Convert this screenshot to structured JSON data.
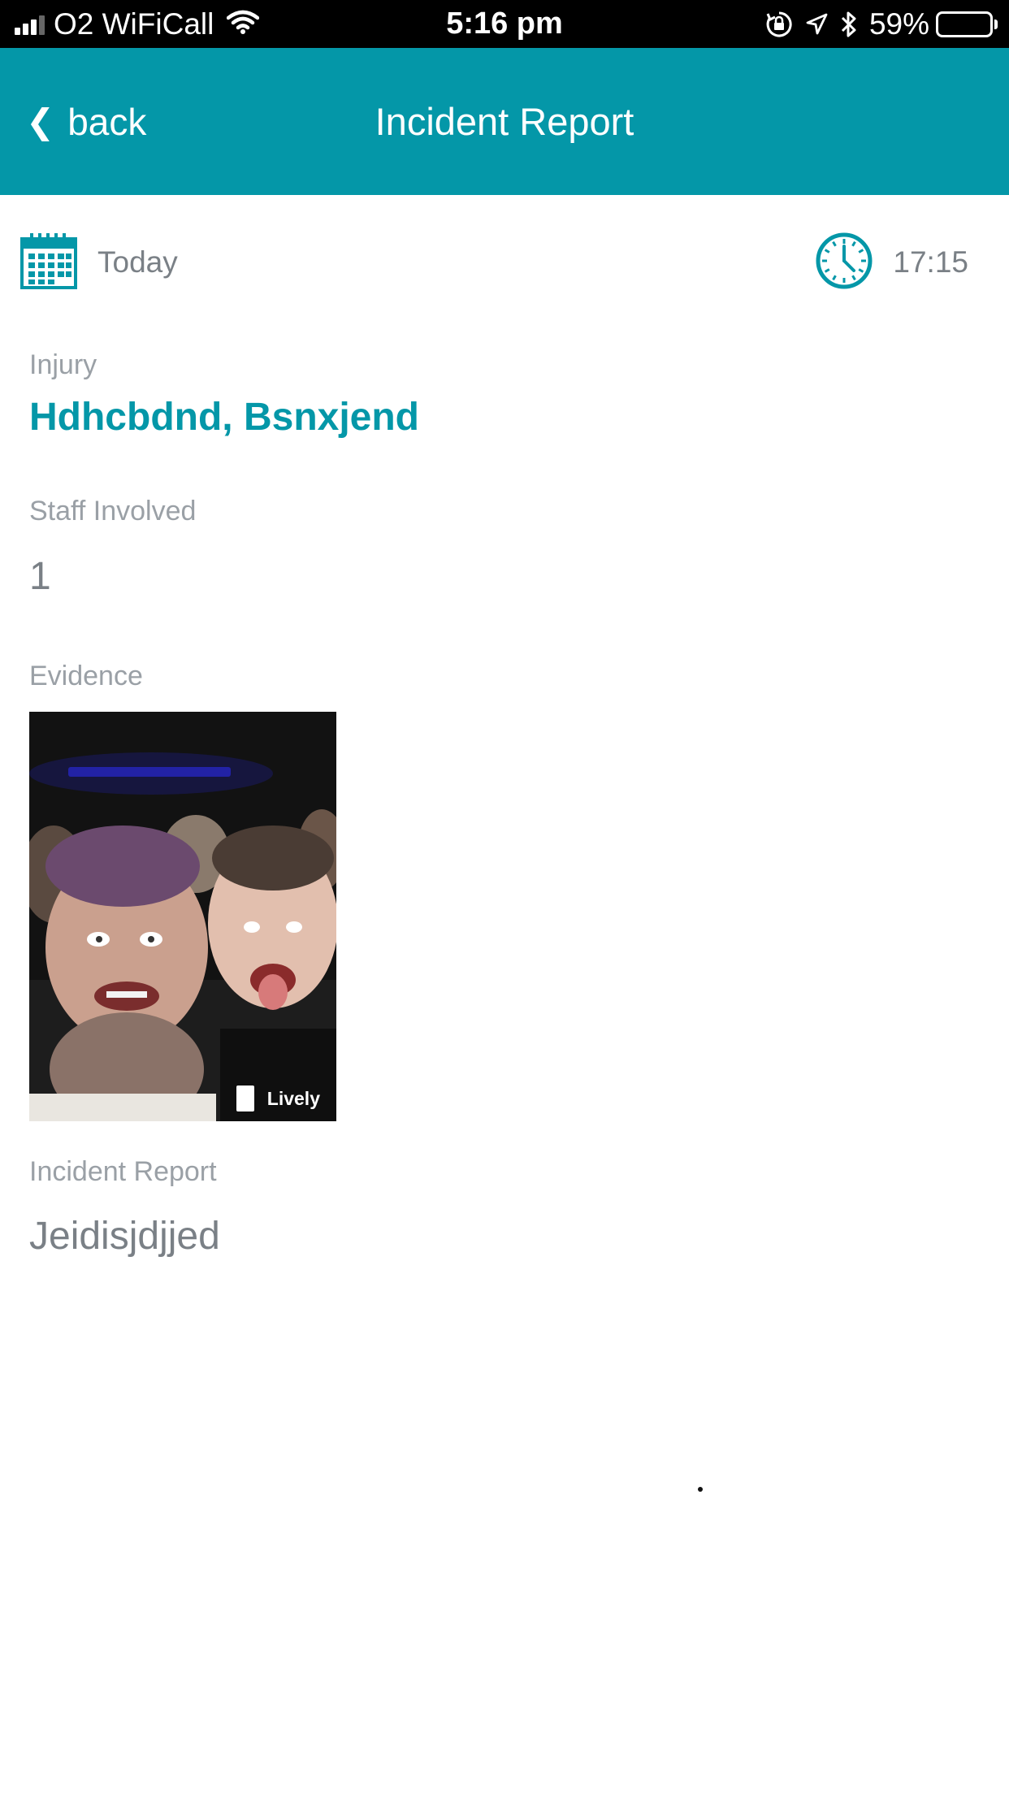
{
  "status_bar": {
    "carrier": "O2 WiFiCall",
    "time": "5:16 pm",
    "battery_percent": "59%",
    "battery_level": 0.59,
    "signal_bars": 3,
    "icons": [
      "wifi-icon",
      "orientation-lock-icon",
      "location-arrow-icon",
      "bluetooth-icon",
      "battery-icon"
    ]
  },
  "nav": {
    "back_label": "back",
    "back_icon": "chevron-left-icon",
    "title": "Incident Report",
    "color": "#0497a8"
  },
  "datetime": {
    "date_icon": "calendar-icon",
    "date": "Today",
    "time_icon": "clock-icon",
    "time": "17:15"
  },
  "fields": {
    "injury_label": "Injury",
    "injury_value": "Hdhcbdnd, Bsnxjend",
    "staff_label": "Staff Involved",
    "staff_value": "1",
    "evidence_label": "Evidence",
    "evidence_badge": "Lively",
    "report_label": "Incident Report",
    "report_value": "Jeidisjdjjed"
  },
  "colors": {
    "accent": "#0497a8",
    "label": "#9aa0a6",
    "value": "#7a8086",
    "status_bar": "#000000"
  }
}
